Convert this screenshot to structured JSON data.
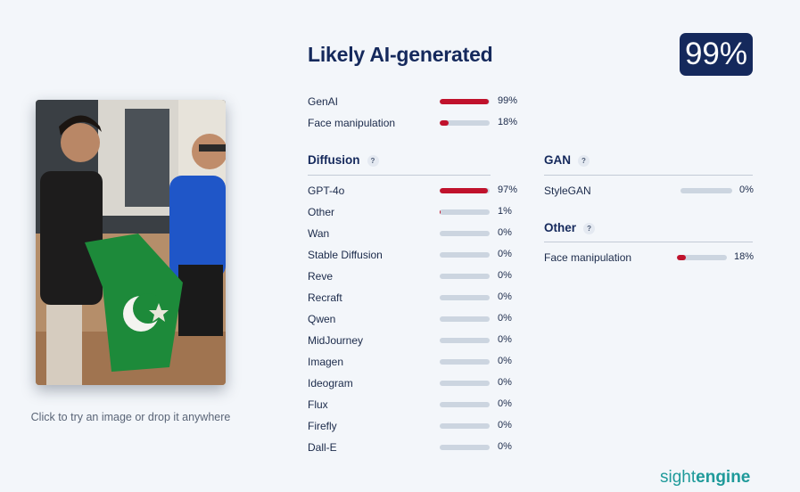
{
  "upload": {
    "hint": "Click to try an image or drop it anywhere"
  },
  "header": {
    "verdict": "Likely AI-generated",
    "score": "99%"
  },
  "summary": [
    {
      "label": "GenAI",
      "value": 99,
      "pct": "99%"
    },
    {
      "label": "Face manipulation",
      "value": 18,
      "pct": "18%"
    }
  ],
  "diffusion": {
    "title": "Diffusion",
    "help": "?",
    "items": [
      {
        "label": "GPT-4o",
        "value": 97,
        "pct": "97%"
      },
      {
        "label": "Other",
        "value": 1,
        "pct": "1%"
      },
      {
        "label": "Wan",
        "value": 0,
        "pct": "0%"
      },
      {
        "label": "Stable Diffusion",
        "value": 0,
        "pct": "0%"
      },
      {
        "label": "Reve",
        "value": 0,
        "pct": "0%"
      },
      {
        "label": "Recraft",
        "value": 0,
        "pct": "0%"
      },
      {
        "label": "Qwen",
        "value": 0,
        "pct": "0%"
      },
      {
        "label": "MidJourney",
        "value": 0,
        "pct": "0%"
      },
      {
        "label": "Imagen",
        "value": 0,
        "pct": "0%"
      },
      {
        "label": "Ideogram",
        "value": 0,
        "pct": "0%"
      },
      {
        "label": "Flux",
        "value": 0,
        "pct": "0%"
      },
      {
        "label": "Firefly",
        "value": 0,
        "pct": "0%"
      },
      {
        "label": "Dall-E",
        "value": 0,
        "pct": "0%"
      }
    ]
  },
  "gan": {
    "title": "GAN",
    "help": "?",
    "items": [
      {
        "label": "StyleGAN",
        "value": 0,
        "pct": "0%"
      }
    ]
  },
  "other": {
    "title": "Other",
    "help": "?",
    "items": [
      {
        "label": "Face manipulation",
        "value": 18,
        "pct": "18%"
      }
    ]
  },
  "brand": {
    "part1": "sight",
    "part2": "engine"
  },
  "colors": {
    "navy": "#15295c",
    "bar_fill": "#c0122c",
    "bar_track": "#ccd5e0",
    "brand": "#1f9a9a"
  }
}
